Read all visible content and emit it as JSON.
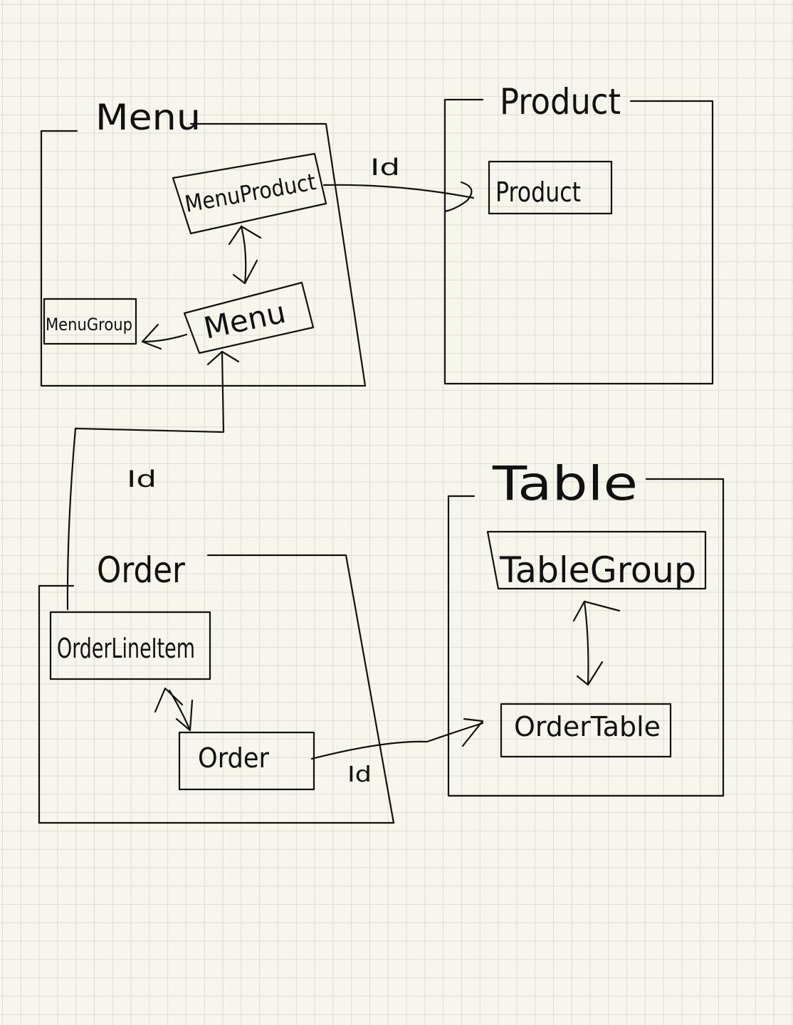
{
  "diagram": {
    "contexts": {
      "menu": {
        "title": "Menu"
      },
      "product": {
        "title": "Product"
      },
      "table": {
        "title": "Table"
      },
      "order": {
        "title": "Order"
      }
    },
    "entities": {
      "menu_product": "MenuProduct",
      "menu": "Menu",
      "menu_group": "MenuGroup",
      "product": "Product",
      "table_group": "TableGroup",
      "order_table": "OrderTable",
      "order_line_item": "OrderLineItem",
      "order": "Order"
    },
    "relations": {
      "menu_product_to_product": "Id",
      "order_line_item_to_menu": "Id",
      "order_to_order_table": "Id"
    }
  }
}
